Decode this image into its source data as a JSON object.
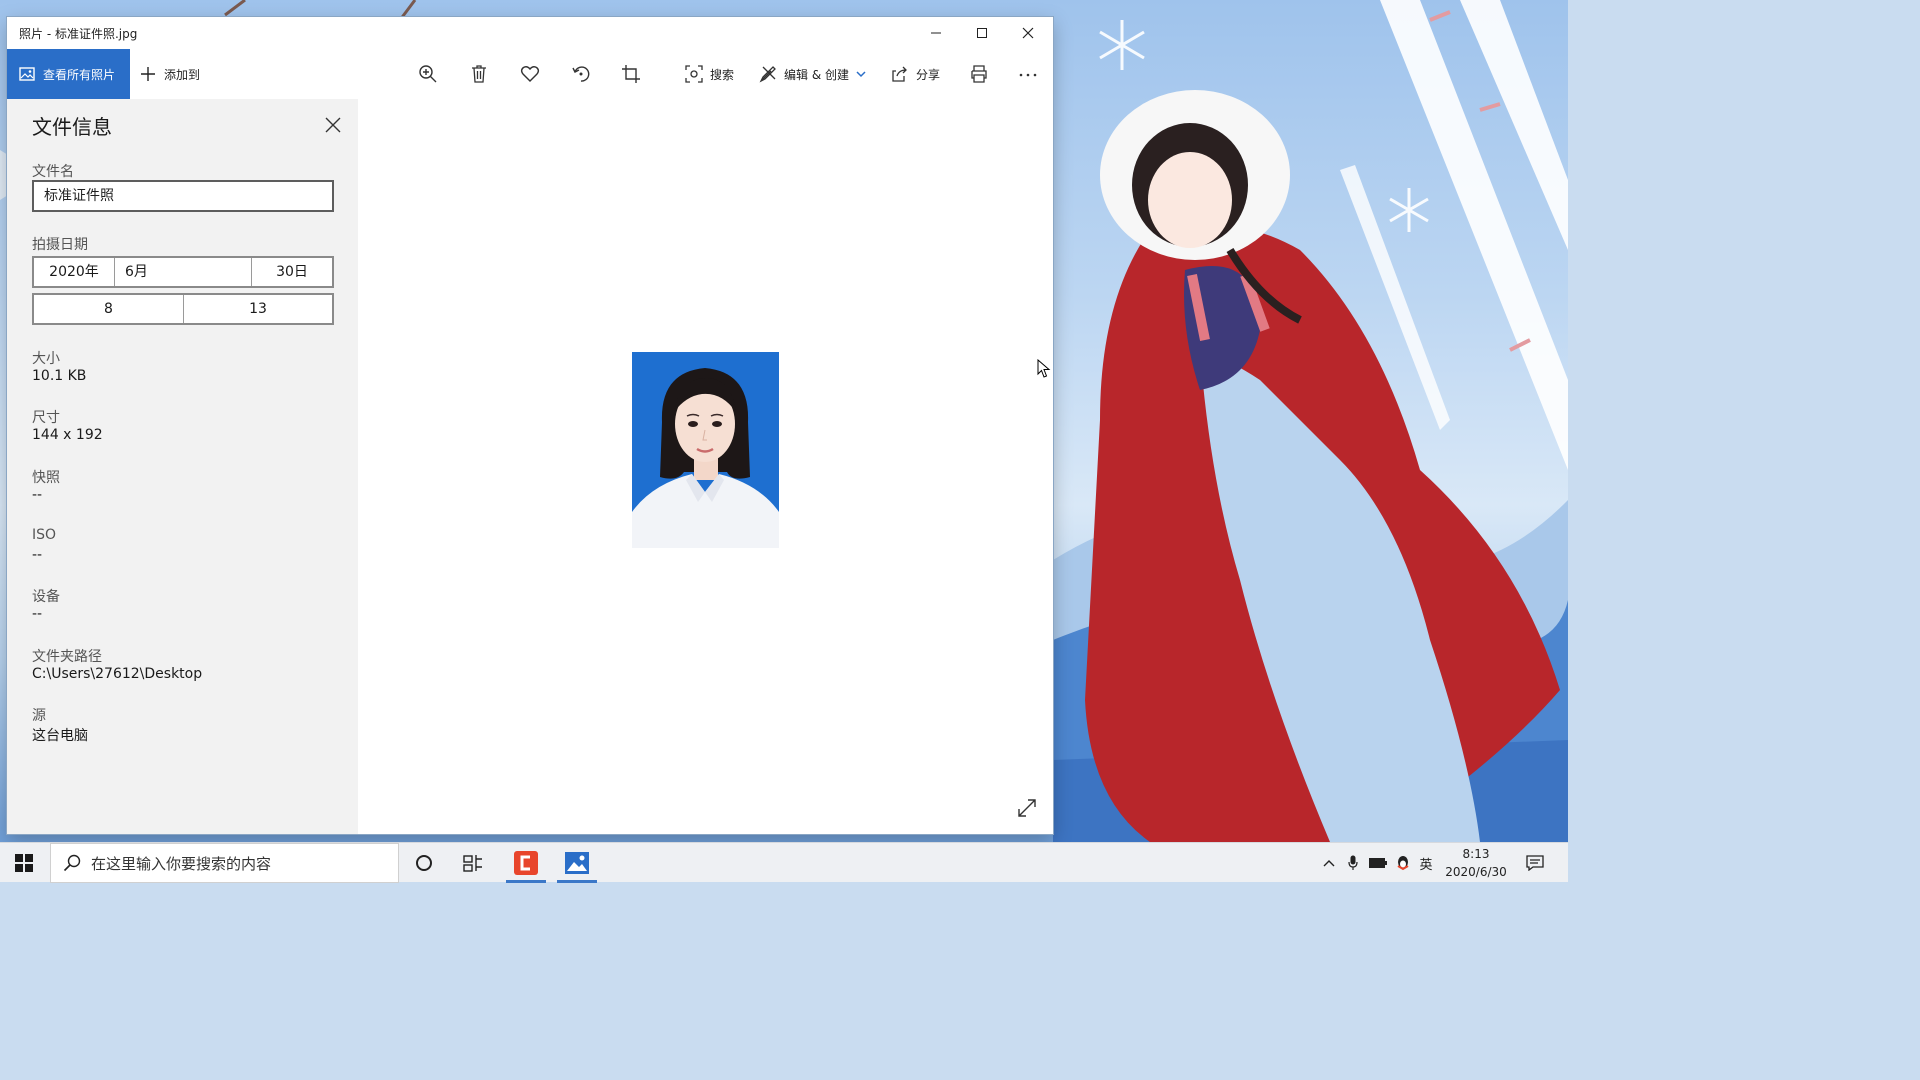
{
  "window": {
    "title": "照片 - 标准证件照.jpg"
  },
  "toolbar": {
    "view_all_label": "查看所有照片",
    "add_to_label": "添加到",
    "search_label": "搜索",
    "edit_create_label": "编辑 & 创建",
    "share_label": "分享",
    "icons": [
      "zoom-in-icon",
      "delete-icon",
      "favorite-icon",
      "rotate-icon",
      "crop-icon",
      "visual-search-icon",
      "edit-icon",
      "share-icon",
      "print-icon",
      "more-icon"
    ]
  },
  "info_panel": {
    "title": "文件信息",
    "filename_label": "文件名",
    "filename_value": "标准证件照",
    "date_label": "拍摄日期",
    "date_year": "2020年",
    "date_month": "6月",
    "date_day": "30日",
    "time_hour": "8",
    "time_minute": "13",
    "size_label": "大小",
    "size_value": "10.1 KB",
    "dimensions_label": "尺寸",
    "dimensions_value": "144 x 192",
    "shutter_label": "快照",
    "shutter_value": "--",
    "iso_label": "ISO",
    "iso_value": "--",
    "device_label": "设备",
    "device_value": "--",
    "folder_label": "文件夹路径",
    "folder_value": "C:\\Users\\27612\\Desktop",
    "source_label": "源",
    "source_value": "这台电脑"
  },
  "taskbar": {
    "search_placeholder": "在这里输入你要搜索的内容",
    "ime_label": "英",
    "time": "8:13",
    "date": "2020/6/30"
  },
  "colors": {
    "accent": "#2a6ec8",
    "panel_bg": "#f2f2f2",
    "photo_bg": "#1e6fd0",
    "cloak_red": "#b8262b"
  }
}
